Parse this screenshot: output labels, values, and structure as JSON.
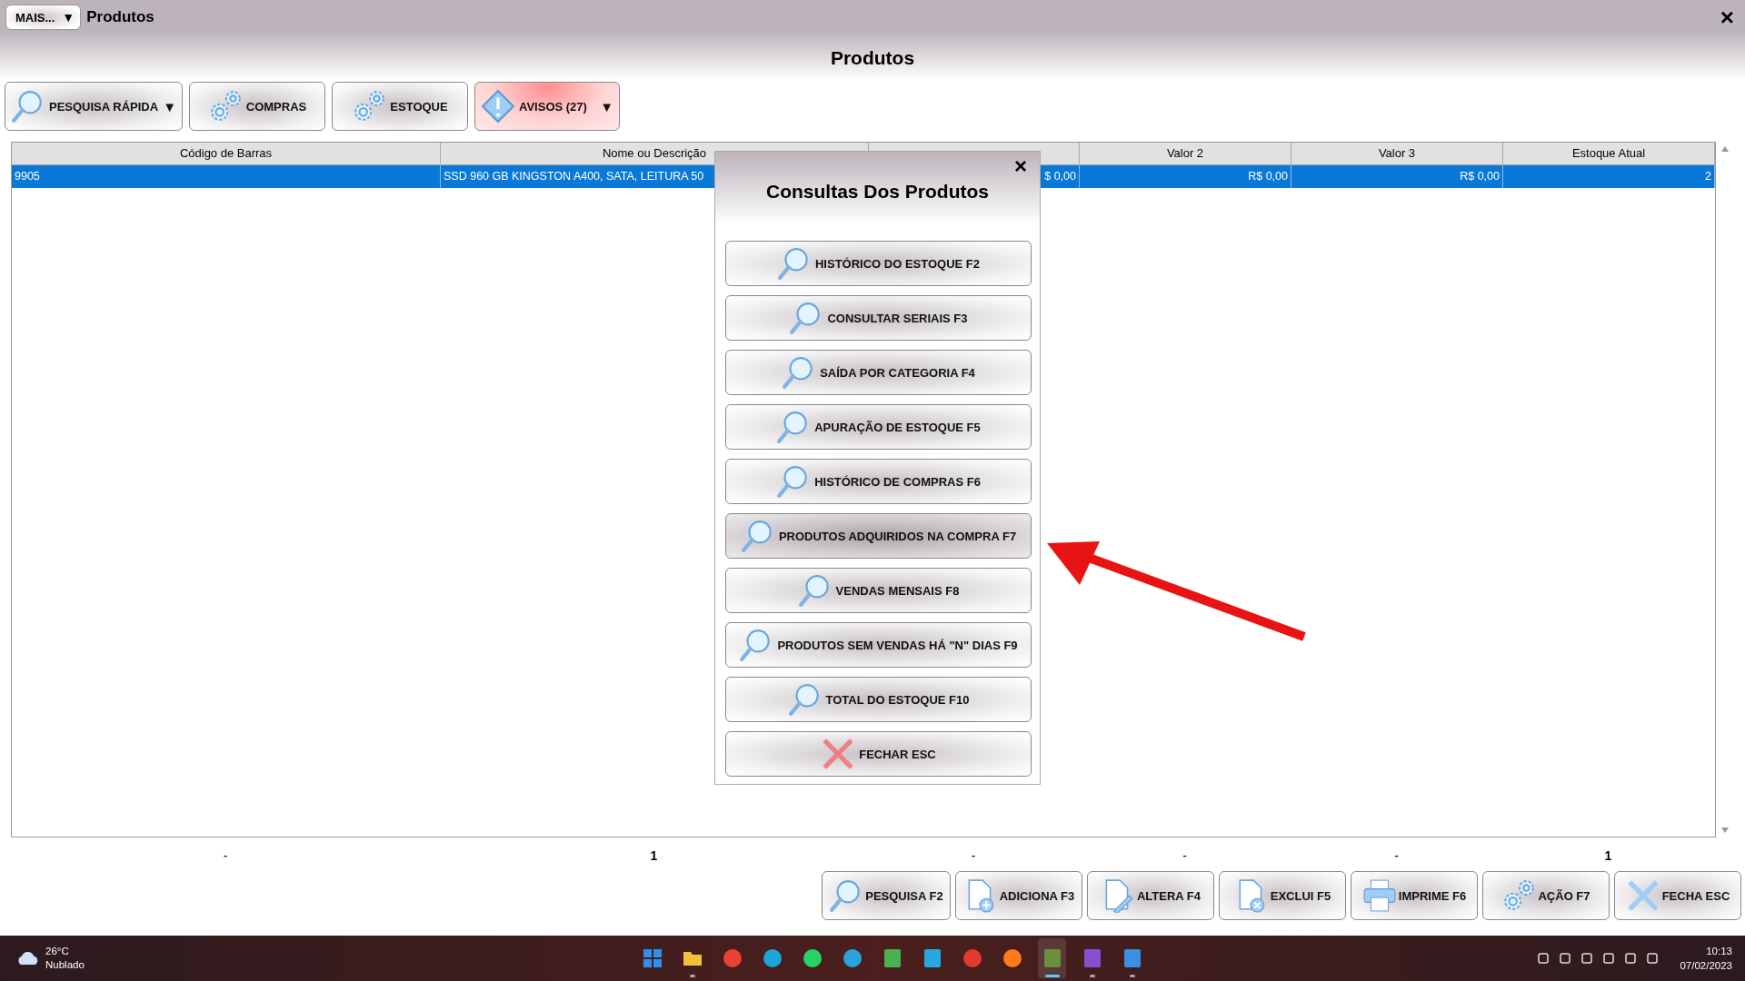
{
  "window": {
    "menu_button": {
      "label": "MAIS...",
      "arrow": "▼"
    },
    "title": "Produtos",
    "close": "×"
  },
  "page_title": "Produtos",
  "toolbar": [
    {
      "label": "PESQUISA RÁPIDA",
      "kind": "search",
      "alert": false,
      "dropdown": "▼"
    },
    {
      "label": "COMPRAS",
      "kind": "gears",
      "alert": false
    },
    {
      "label": "ESTOQUE",
      "kind": "gears",
      "alert": false
    },
    {
      "label": "AVISOS (27)",
      "kind": "warning",
      "alert": true,
      "dropdown": "▼"
    }
  ],
  "table": {
    "columns": [
      {
        "label": "Código de Barras"
      },
      {
        "label": "Nome ou Descrição"
      },
      {},
      {
        "label": "Valor 2"
      },
      {
        "label": "Valor 3"
      },
      {
        "label": "Estoque Atual"
      }
    ],
    "rows": [
      {
        "selected": true,
        "cells": [
          "9905",
          "SSD 960 GB KINGSTON A400, SATA, LEITURA 50",
          "$ 0,00",
          "R$ 0,00",
          "R$ 0,00",
          "2"
        ]
      }
    ],
    "totals": [
      "-",
      "1",
      "-",
      "-",
      "-",
      "1"
    ]
  },
  "dialog": {
    "title": "Consultas Dos Produtos",
    "close": "×",
    "items": [
      {
        "label": "HISTÓRICO DO ESTOQUE F2",
        "kind": "search",
        "hovered": false
      },
      {
        "label": "CONSULTAR SERIAIS F3",
        "kind": "search",
        "hovered": false
      },
      {
        "label": "SAÍDA POR CATEGORIA F4",
        "kind": "search",
        "hovered": false
      },
      {
        "label": "APURAÇÃO DE ESTOQUE F5",
        "kind": "search",
        "hovered": false
      },
      {
        "label": "HISTÓRICO DE COMPRAS F6",
        "kind": "search",
        "hovered": false
      },
      {
        "label": "PRODUTOS ADQUIRIDOS NA COMPRA F7",
        "kind": "search",
        "hovered": true
      },
      {
        "label": "VENDAS MENSAIS F8",
        "kind": "search",
        "hovered": false
      },
      {
        "label": "PRODUTOS SEM VENDAS HÁ \"N\" DIAS F9",
        "kind": "search",
        "hovered": false
      },
      {
        "label": "TOTAL DO ESTOQUE F10",
        "kind": "search",
        "hovered": false
      },
      {
        "label": "FECHAR ESC",
        "kind": "close-red",
        "hovered": false
      }
    ]
  },
  "bottom_buttons": [
    {
      "label": "PESQUISA F2",
      "kind": "search"
    },
    {
      "label": "ADICIONA F3",
      "kind": "doc-plus"
    },
    {
      "label": "ALTERA F4",
      "kind": "doc-pen"
    },
    {
      "label": "EXCLUI F5",
      "kind": "doc-x"
    },
    {
      "label": "IMPRIME F6",
      "kind": "printer"
    },
    {
      "label": "AÇÃO F7",
      "kind": "gears"
    },
    {
      "label": "FECHA ESC",
      "kind": "close-blue"
    }
  ],
  "taskbar": {
    "weather": {
      "temperature": "26°C",
      "condition": "Nublado"
    },
    "apps": [
      {
        "kind": "grid",
        "color": "#2f8ff0",
        "running": false,
        "active": false
      },
      {
        "kind": "folder",
        "color": "#f2c13c",
        "running": true,
        "active": false
      },
      {
        "kind": "circle",
        "color": "#e94235",
        "running": false,
        "active": false
      },
      {
        "kind": "circle",
        "color": "#1ba5d8",
        "running": false,
        "active": false
      },
      {
        "kind": "circle",
        "color": "#25d366",
        "running": false,
        "active": false
      },
      {
        "kind": "circle",
        "color": "#2aa3dc",
        "running": false,
        "active": false
      },
      {
        "kind": "square",
        "color": "#4caf50",
        "running": false,
        "active": false
      },
      {
        "kind": "square",
        "color": "#29a8e0",
        "running": false,
        "active": false
      },
      {
        "kind": "circle",
        "color": "#e23a2e",
        "running": false,
        "active": false
      },
      {
        "kind": "circle",
        "color": "#ff7a1a",
        "running": false,
        "active": false
      },
      {
        "kind": "square",
        "color": "#6b8f3a",
        "running": true,
        "active": true
      },
      {
        "kind": "square",
        "color": "#8a4fd0",
        "running": true,
        "active": false
      },
      {
        "kind": "square",
        "color": "#3a8fe0",
        "running": true,
        "active": false
      }
    ],
    "clock": {
      "time": "10:13",
      "date": "07/02/2023"
    }
  }
}
